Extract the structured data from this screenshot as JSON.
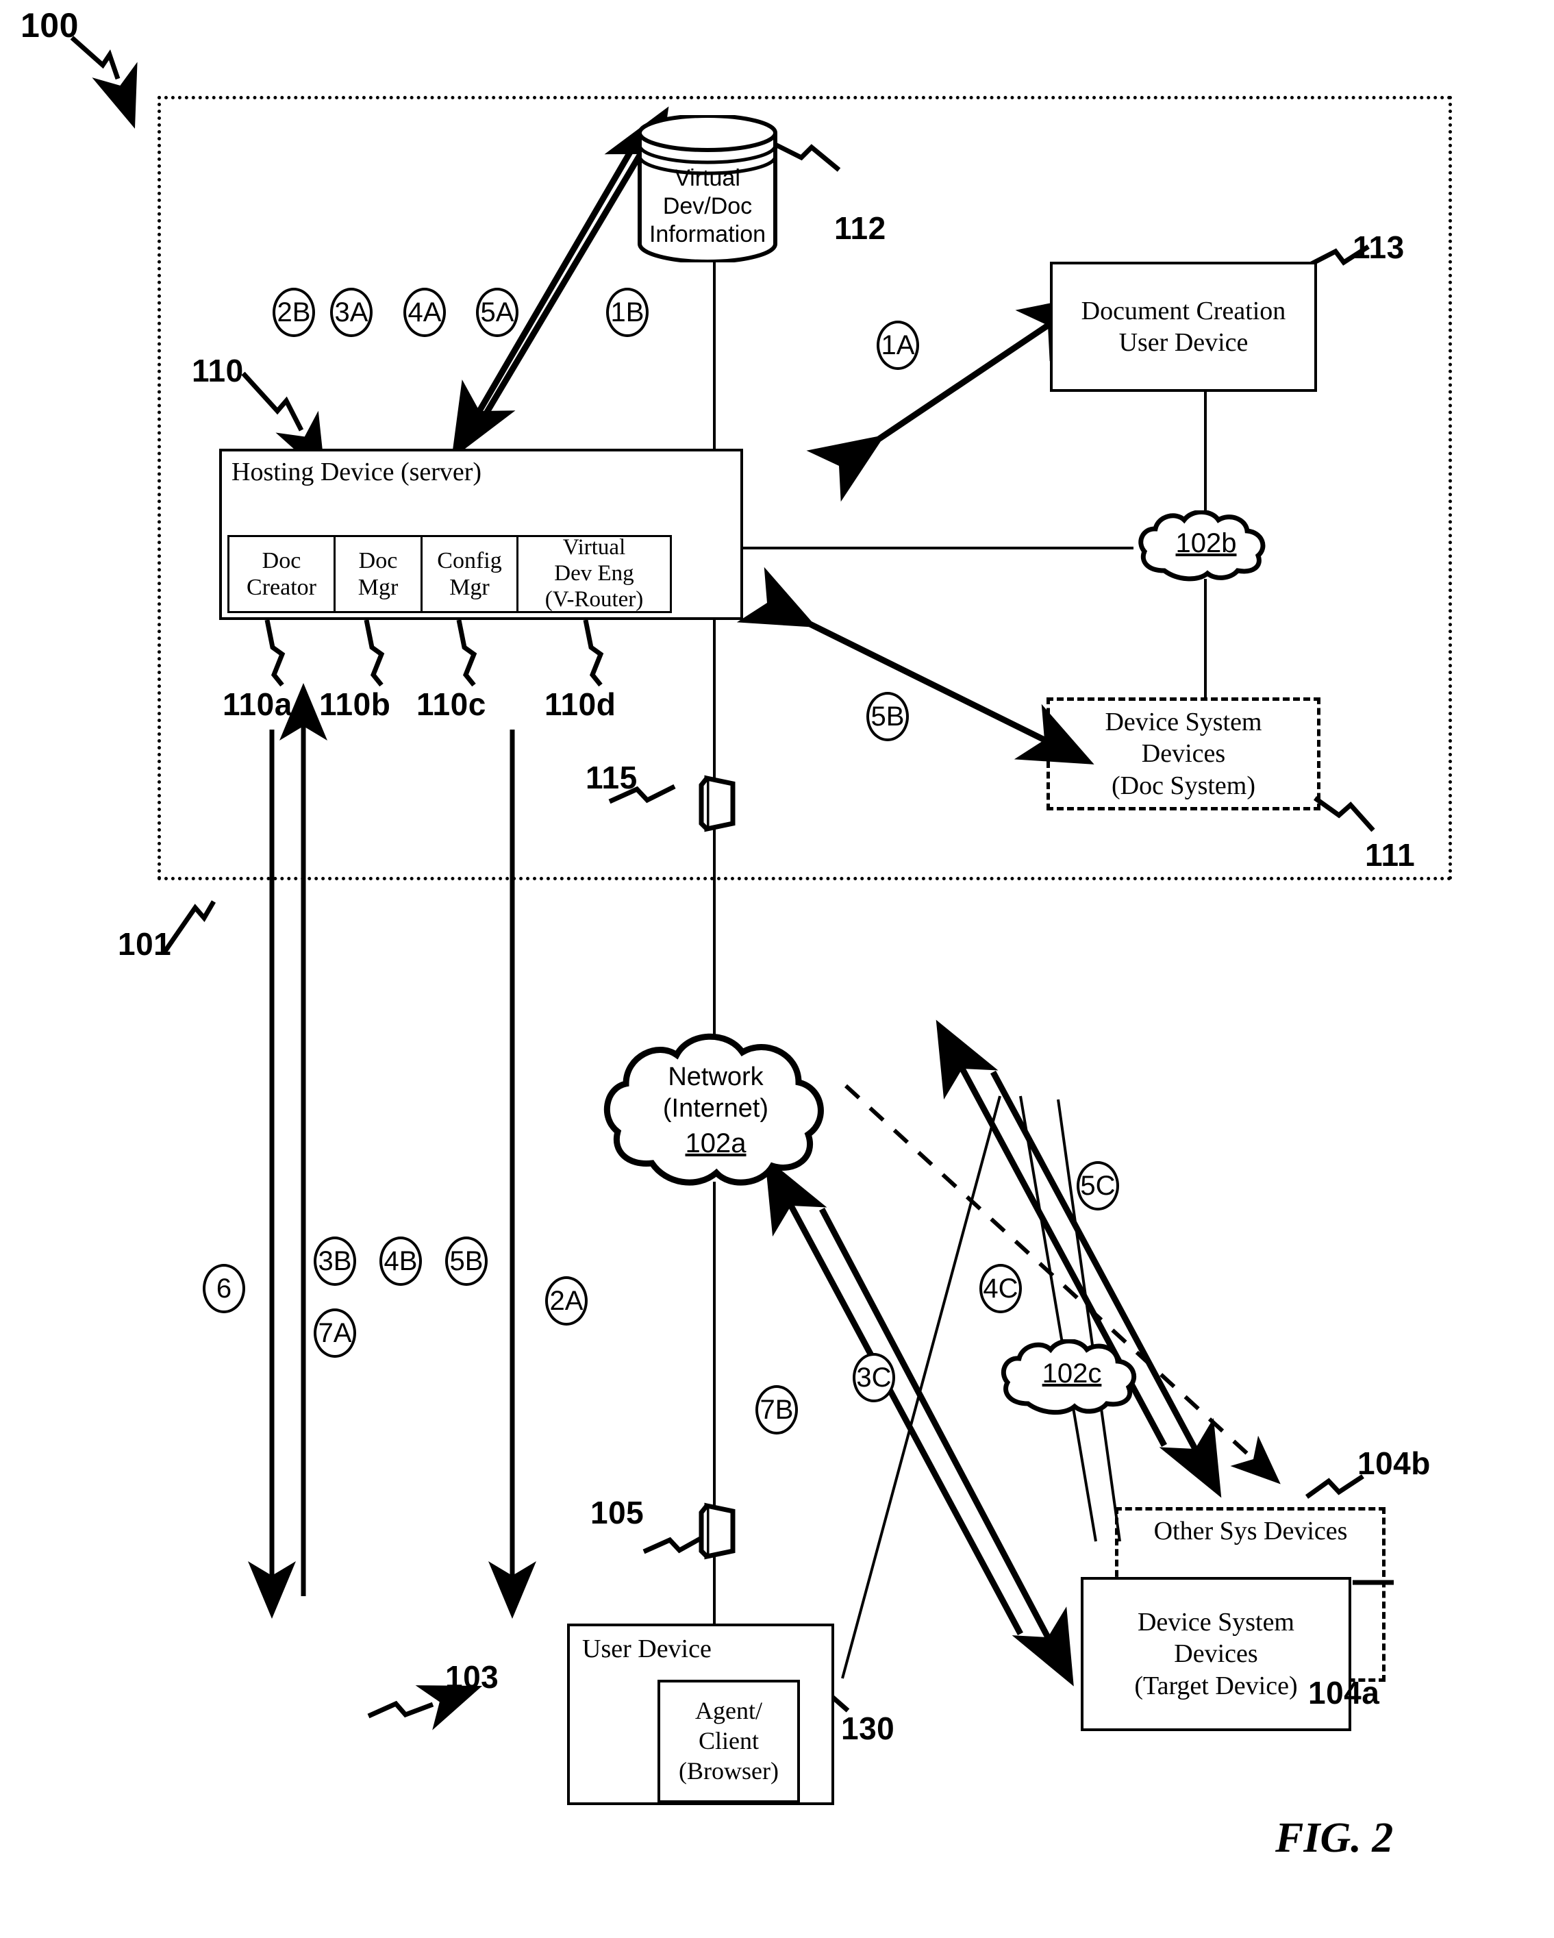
{
  "figure": {
    "caption": "FIG. 2",
    "system_ref": "100",
    "boundary_ref": "101"
  },
  "database": {
    "label": "Virtual\nDev/Doc\nInformation",
    "ref": "112"
  },
  "hosting_device": {
    "title": "Hosting Device (server)",
    "ref": "110",
    "modules": [
      {
        "label": "Doc\nCreator",
        "ref": "110a"
      },
      {
        "label": "Doc\nMgr",
        "ref": "110b"
      },
      {
        "label": "Config\nMgr",
        "ref": "110c"
      },
      {
        "label": "Virtual\nDev Eng\n(V-Router)",
        "ref": "110d"
      }
    ]
  },
  "doc_creation_user_device": {
    "label": "Document Creation\nUser Device",
    "ref": "113"
  },
  "device_system_doc": {
    "label": "Device System\nDevices\n(Doc System)",
    "ref": "111"
  },
  "network": {
    "label": "Network\n(Internet)",
    "id": "102a"
  },
  "cloud_102b": {
    "id": "102b"
  },
  "cloud_102c": {
    "id": "102c"
  },
  "user_device": {
    "title": "User Device",
    "ref": "103",
    "inner": {
      "label": "Agent/\nClient\n(Browser)",
      "ref": "130"
    }
  },
  "other_sys_devices": {
    "label": "Other Sys Devices",
    "ref": "104b"
  },
  "target_device": {
    "label": "Device System\nDevices\n(Target Device)",
    "ref": "104a"
  },
  "firewalls": [
    {
      "ref": "115"
    },
    {
      "ref": "105"
    }
  ],
  "steps": {
    "top_row": [
      "2B",
      "3A",
      "4A",
      "5A",
      "1B"
    ],
    "right_upper": "1A",
    "right_lower": "5B",
    "left_column": [
      "6"
    ],
    "mid_left_row": [
      "3B",
      "4B",
      "5B"
    ],
    "mid_left_second": "7A",
    "mid_right": "2A",
    "lower_right": [
      "7B",
      "3C",
      "4C",
      "5C"
    ]
  }
}
